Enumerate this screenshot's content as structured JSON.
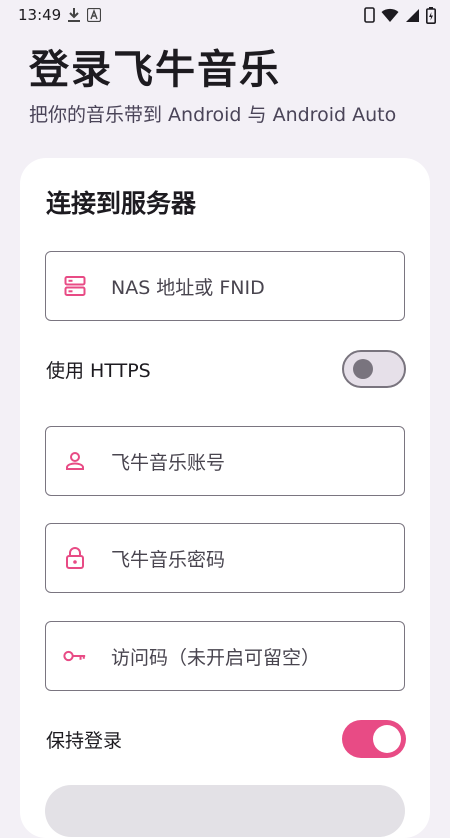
{
  "status_bar": {
    "time": "13:49",
    "left_icons": [
      "download-icon",
      "keyboard-a-icon"
    ],
    "right_icons": [
      "phone-icon",
      "wifi-icon",
      "signal-icon",
      "battery-icon"
    ]
  },
  "header": {
    "title": "登录飞牛音乐",
    "subtitle": "把你的音乐带到 Android 与 Android Auto"
  },
  "card": {
    "title": "连接到服务器",
    "server_field": {
      "icon": "server-icon",
      "placeholder": "NAS 地址或 FNID",
      "value": ""
    },
    "https_toggle": {
      "label": "使用 HTTPS",
      "on": false
    },
    "account_field": {
      "icon": "person-icon",
      "placeholder": "飞牛音乐账号",
      "value": ""
    },
    "password_field": {
      "icon": "lock-icon",
      "placeholder": "飞牛音乐密码",
      "value": ""
    },
    "access_code_field": {
      "icon": "key-icon",
      "placeholder": "访问码（未开启可留空）",
      "value": ""
    },
    "keep_login_toggle": {
      "label": "保持登录",
      "on": true
    }
  },
  "colors": {
    "accent": "#e84b85",
    "background": "#f3f0f6",
    "card": "#ffffff",
    "outline": "#7a7580"
  }
}
